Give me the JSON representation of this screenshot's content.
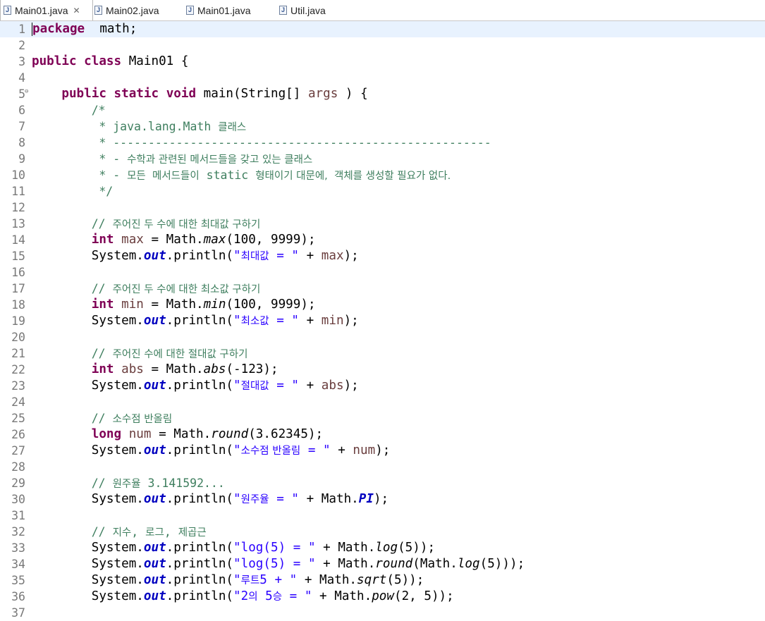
{
  "tabs": [
    {
      "label": "Main01.java",
      "active": true,
      "closable": true,
      "icon": "java-file-icon"
    },
    {
      "label": "Main02.java",
      "active": false,
      "icon": "java-file-icon"
    },
    {
      "label": "Main01.java",
      "active": false,
      "icon": "java-file-icon"
    },
    {
      "label": "Util.java",
      "active": false,
      "icon": "java-file-icon"
    }
  ],
  "editor": {
    "current_line": 1,
    "lines": [
      {
        "n": "1",
        "s": [
          [
            "kw",
            "package"
          ],
          [
            "",
            "  math;"
          ]
        ]
      },
      {
        "n": "2",
        "s": []
      },
      {
        "n": "3",
        "s": [
          [
            "kw",
            "public"
          ],
          [
            "",
            " "
          ],
          [
            "kw",
            "class"
          ],
          [
            "",
            " Main01 {"
          ]
        ]
      },
      {
        "n": "4",
        "s": []
      },
      {
        "n": "5",
        "fold": true,
        "s": [
          [
            "",
            "    "
          ],
          [
            "kw",
            "public"
          ],
          [
            "",
            " "
          ],
          [
            "kw",
            "static"
          ],
          [
            "",
            " "
          ],
          [
            "kw",
            "void"
          ],
          [
            "",
            " main(String[] "
          ],
          [
            "var",
            "args"
          ],
          [
            "",
            " ) {"
          ]
        ]
      },
      {
        "n": "6",
        "s": [
          [
            "",
            "        "
          ],
          [
            "cm",
            "/*"
          ]
        ]
      },
      {
        "n": "7",
        "s": [
          [
            "",
            "         "
          ],
          [
            "cm",
            "* java.lang.Math "
          ],
          [
            "cm ko",
            "클래스"
          ]
        ]
      },
      {
        "n": "8",
        "s": [
          [
            "",
            "         "
          ],
          [
            "cm",
            "* ------------------------------------------------------"
          ]
        ]
      },
      {
        "n": "9",
        "s": [
          [
            "",
            "         "
          ],
          [
            "cm",
            "* - "
          ],
          [
            "cm ko",
            "수학과 관련된 메서드들을 갖고 있는 클래스"
          ]
        ]
      },
      {
        "n": "10",
        "s": [
          [
            "",
            "         "
          ],
          [
            "cm",
            "* - "
          ],
          [
            "cm ko",
            "모든  메서드들이"
          ],
          [
            "cm",
            " static "
          ],
          [
            "cm ko",
            "형태이기 대문에,  객체를 생성할 필요가 없다."
          ]
        ]
      },
      {
        "n": "11",
        "s": [
          [
            "",
            "         "
          ],
          [
            "cm",
            "*/"
          ]
        ]
      },
      {
        "n": "12",
        "s": []
      },
      {
        "n": "13",
        "s": [
          [
            "",
            "        "
          ],
          [
            "cm",
            "// "
          ],
          [
            "cm ko",
            "주어진 두 수에 대한 최대값 구하기"
          ]
        ]
      },
      {
        "n": "14",
        "s": [
          [
            "",
            "        "
          ],
          [
            "kw",
            "int"
          ],
          [
            "",
            " "
          ],
          [
            "var",
            "max"
          ],
          [
            "",
            " = Math."
          ],
          [
            "it",
            "max"
          ],
          [
            "",
            "(100, 9999);"
          ]
        ]
      },
      {
        "n": "15",
        "s": [
          [
            "",
            "        System."
          ],
          [
            "fld",
            "out"
          ],
          [
            "",
            ".println("
          ],
          [
            "str",
            "\""
          ],
          [
            "str ko",
            "최대값"
          ],
          [
            "str",
            " = \""
          ],
          [
            "",
            " + "
          ],
          [
            "var",
            "max"
          ],
          [
            "",
            ");"
          ]
        ]
      },
      {
        "n": "16",
        "s": []
      },
      {
        "n": "17",
        "s": [
          [
            "",
            "        "
          ],
          [
            "cm",
            "// "
          ],
          [
            "cm ko",
            "주어진 두 수에 대한 최소값 구하기"
          ]
        ]
      },
      {
        "n": "18",
        "s": [
          [
            "",
            "        "
          ],
          [
            "kw",
            "int"
          ],
          [
            "",
            " "
          ],
          [
            "var",
            "min"
          ],
          [
            "",
            " = Math."
          ],
          [
            "it",
            "min"
          ],
          [
            "",
            "(100, 9999);"
          ]
        ]
      },
      {
        "n": "19",
        "s": [
          [
            "",
            "        System."
          ],
          [
            "fld",
            "out"
          ],
          [
            "",
            ".println("
          ],
          [
            "str",
            "\""
          ],
          [
            "str ko",
            "최소값"
          ],
          [
            "str",
            " = \""
          ],
          [
            "",
            " + "
          ],
          [
            "var",
            "min"
          ],
          [
            "",
            ");"
          ]
        ]
      },
      {
        "n": "20",
        "s": []
      },
      {
        "n": "21",
        "s": [
          [
            "",
            "        "
          ],
          [
            "cm",
            "// "
          ],
          [
            "cm ko",
            "주어진 수에 대한 절대값 구하기"
          ]
        ]
      },
      {
        "n": "22",
        "s": [
          [
            "",
            "        "
          ],
          [
            "kw",
            "int"
          ],
          [
            "",
            " "
          ],
          [
            "var",
            "abs"
          ],
          [
            "",
            " = Math."
          ],
          [
            "it",
            "abs"
          ],
          [
            "",
            "(-123);"
          ]
        ]
      },
      {
        "n": "23",
        "s": [
          [
            "",
            "        System."
          ],
          [
            "fld",
            "out"
          ],
          [
            "",
            ".println("
          ],
          [
            "str",
            "\""
          ],
          [
            "str ko",
            "절대값"
          ],
          [
            "str",
            " = \""
          ],
          [
            "",
            " + "
          ],
          [
            "var",
            "abs"
          ],
          [
            "",
            ");"
          ]
        ]
      },
      {
        "n": "24",
        "s": []
      },
      {
        "n": "25",
        "s": [
          [
            "",
            "        "
          ],
          [
            "cm",
            "// "
          ],
          [
            "cm ko",
            "소수점 반올림"
          ]
        ]
      },
      {
        "n": "26",
        "s": [
          [
            "",
            "        "
          ],
          [
            "kw",
            "long"
          ],
          [
            "",
            " "
          ],
          [
            "var",
            "num"
          ],
          [
            "",
            " = Math."
          ],
          [
            "it",
            "round"
          ],
          [
            "",
            "(3.62345);"
          ]
        ]
      },
      {
        "n": "27",
        "s": [
          [
            "",
            "        System."
          ],
          [
            "fld",
            "out"
          ],
          [
            "",
            ".println("
          ],
          [
            "str",
            "\""
          ],
          [
            "str ko",
            "소수점 반올림"
          ],
          [
            "str",
            " = \""
          ],
          [
            "",
            " + "
          ],
          [
            "var",
            "num"
          ],
          [
            "",
            ");"
          ]
        ]
      },
      {
        "n": "28",
        "s": []
      },
      {
        "n": "29",
        "s": [
          [
            "",
            "        "
          ],
          [
            "cm",
            "// "
          ],
          [
            "cm ko",
            "원주율"
          ],
          [
            "cm",
            " 3.141592..."
          ]
        ]
      },
      {
        "n": "30",
        "s": [
          [
            "",
            "        System."
          ],
          [
            "fld",
            "out"
          ],
          [
            "",
            ".println("
          ],
          [
            "str",
            "\""
          ],
          [
            "str ko",
            "원주율"
          ],
          [
            "str",
            " = \""
          ],
          [
            "",
            " + Math."
          ],
          [
            "fld",
            "PI"
          ],
          [
            "",
            ");"
          ]
        ]
      },
      {
        "n": "31",
        "s": []
      },
      {
        "n": "32",
        "s": [
          [
            "",
            "        "
          ],
          [
            "cm",
            "// "
          ],
          [
            "cm ko",
            "지수"
          ],
          [
            "cm",
            ", "
          ],
          [
            "cm ko",
            "로그"
          ],
          [
            "cm",
            ", "
          ],
          [
            "cm ko",
            "제곱근"
          ]
        ]
      },
      {
        "n": "33",
        "s": [
          [
            "",
            "        System."
          ],
          [
            "fld",
            "out"
          ],
          [
            "",
            ".println("
          ],
          [
            "str",
            "\"log(5) = \""
          ],
          [
            "",
            " + Math."
          ],
          [
            "it",
            "log"
          ],
          [
            "",
            "(5));"
          ]
        ]
      },
      {
        "n": "34",
        "s": [
          [
            "",
            "        System."
          ],
          [
            "fld",
            "out"
          ],
          [
            "",
            ".println("
          ],
          [
            "str",
            "\"log(5) = \""
          ],
          [
            "",
            " + Math."
          ],
          [
            "it",
            "round"
          ],
          [
            "",
            "(Math."
          ],
          [
            "it",
            "log"
          ],
          [
            "",
            "(5)));"
          ]
        ]
      },
      {
        "n": "35",
        "s": [
          [
            "",
            "        System."
          ],
          [
            "fld",
            "out"
          ],
          [
            "",
            ".println("
          ],
          [
            "str",
            "\""
          ],
          [
            "str ko",
            "루트"
          ],
          [
            "str",
            "5 + \""
          ],
          [
            "",
            " + Math."
          ],
          [
            "it",
            "sqrt"
          ],
          [
            "",
            "(5));"
          ]
        ]
      },
      {
        "n": "36",
        "s": [
          [
            "",
            "        System."
          ],
          [
            "fld",
            "out"
          ],
          [
            "",
            ".println("
          ],
          [
            "str",
            "\"2"
          ],
          [
            "str ko",
            "의"
          ],
          [
            "str",
            " 5"
          ],
          [
            "str ko",
            "승"
          ],
          [
            "str",
            " = \""
          ],
          [
            "",
            " + Math."
          ],
          [
            "it",
            "pow"
          ],
          [
            "",
            "(2, 5));"
          ]
        ]
      },
      {
        "n": "37",
        "s": []
      }
    ]
  },
  "colors": {
    "keyword": "#7f0055",
    "comment": "#3f7f5f",
    "string": "#2a00ff",
    "field": "#0000c0",
    "variable": "#6a3e3e",
    "current_line_bg": "#e8f2fe"
  }
}
